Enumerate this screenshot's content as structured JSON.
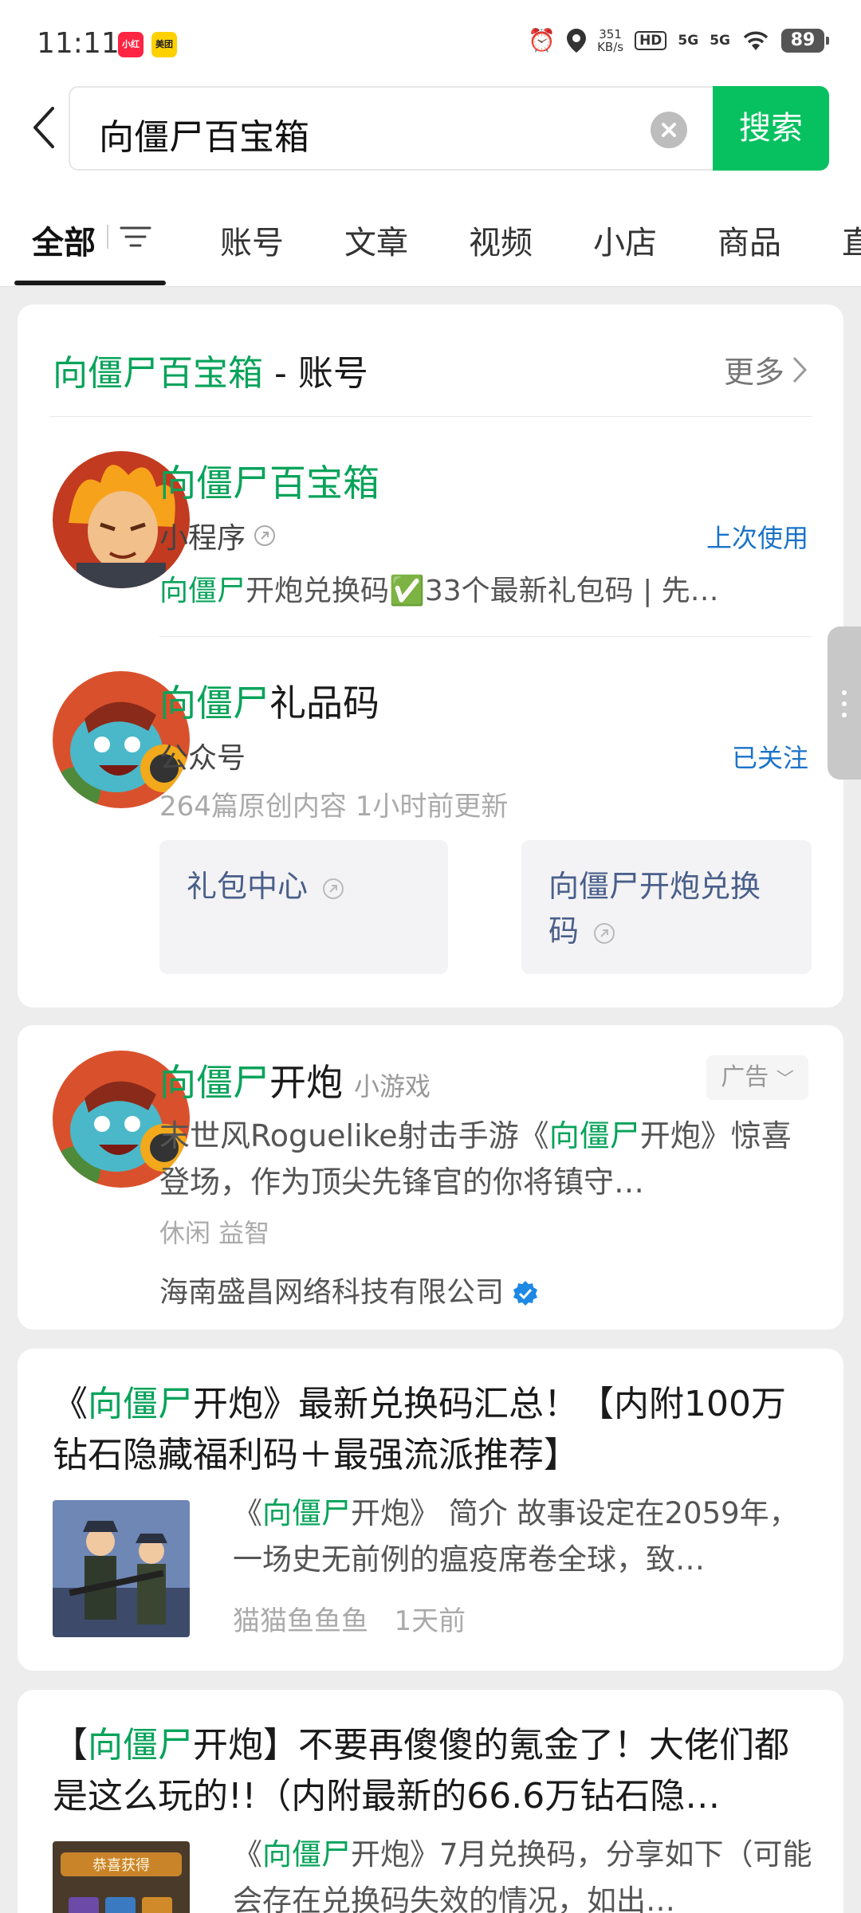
{
  "status_bar": {
    "time": "11:11",
    "app1": "小红书",
    "app2": "美团",
    "speed_value": "351",
    "speed_unit": "KB/s",
    "hd": "HD",
    "net1": "5G",
    "net2": "5G",
    "battery": "89"
  },
  "search": {
    "query": "向僵尸百宝箱",
    "button": "搜索"
  },
  "tabs": {
    "all": "全部",
    "account": "账号",
    "article": "文章",
    "video": "视频",
    "shop": "小店",
    "goods": "商品",
    "live_partial": "直"
  },
  "account_section": {
    "title_hl": "向僵尸百宝箱",
    "title_rest": " - 账号",
    "more": "更多",
    "item1": {
      "name": "向僵尸百宝箱",
      "type": "小程序",
      "status": "上次使用",
      "desc_hl": "向僵尸",
      "desc_rest": "开炮兑换码✅33个最新礼包码 | 先…"
    },
    "item2": {
      "name_hl": "向僵尸",
      "name_rest": "礼品码",
      "type": "公众号",
      "status": "已关注",
      "meta": "264篇原创内容  1小时前更新",
      "box1": "礼包中心",
      "box2": "向僵尸开炮兑换码"
    }
  },
  "ad_card": {
    "name_hl": "向僵尸",
    "name_rest": "开炮",
    "kind": "小游戏",
    "ad_label": "广告",
    "desc_a": "末世风Roguelike射击手游《",
    "desc_hl": "向僵尸",
    "desc_b": "开炮》惊喜登场，作为顶尖先锋官的你将镇守…",
    "tags": "休闲 益智",
    "company": "海南盛昌网络科技有限公司"
  },
  "article1": {
    "t1": "《",
    "t_hl": "向僵尸",
    "t2": "开炮》最新兑换码汇总！【内附100万钻石隐藏福利码＋最强流派推荐】",
    "d1": "《",
    "d_hl": "向僵尸",
    "d2": "开炮》 简介 故事设定在2059年，一场史无前例的瘟疫席卷全球，致…",
    "source": "猫猫鱼鱼鱼",
    "time": "1天前"
  },
  "article2": {
    "t1": "【",
    "t_hl": "向僵尸",
    "t2": "开炮】不要再傻傻的氪金了！大佬们都是这么玩的!!（内附最新的66.6万钻石隐…",
    "d1": "《",
    "d_hl": "向僵尸",
    "d2": "开炮》7月兑换码，分享如下（可能会存在兑换码失效的情况，如出…",
    "thumb_text": "恭喜获得"
  }
}
